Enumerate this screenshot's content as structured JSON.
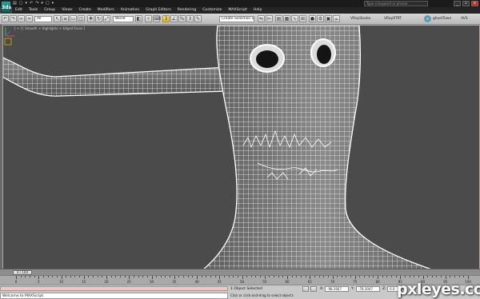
{
  "app": {
    "logo_text": "3ds",
    "title": "",
    "quick_access": [
      "▤",
      "▢",
      "▾",
      "↶",
      "↷",
      "▾",
      "▢",
      "▾"
    ],
    "help_search_placeholder": "Type a keyword or phrase",
    "window_controls": [
      "_",
      "▫",
      "x"
    ]
  },
  "menu": [
    "Edit",
    "Tools",
    "Group",
    "Views",
    "Create",
    "Modifiers",
    "Animation",
    "Graph Editors",
    "Rendering",
    "Customize",
    "MAXScript",
    "Help"
  ],
  "toolbar": {
    "filter_dropdown": "All",
    "refcoord_dropdown": "World",
    "selection_set_placeholder": "Create Selection Se",
    "vray_studio": "VRayStudio",
    "vray_rt": "VRayRTRT",
    "ghost_town": "ghostTown",
    "avs": "AVS"
  },
  "viewport": {
    "label": "[ + ] [ Smooth + Highlights + Edged Faces ]",
    "accent_color": "#e0b000",
    "mesh_color": "#ffffff",
    "background_color": "#4b4b4b"
  },
  "timeline": {
    "frame_readout": "0 / 100",
    "ticks": [
      "0",
      "5",
      "10",
      "15",
      "20",
      "25",
      "30",
      "35",
      "40",
      "45",
      "50",
      "55",
      "60",
      "65",
      "70",
      "75",
      "80",
      "85",
      "90",
      "95",
      "100"
    ]
  },
  "statusbar": {
    "maxscript_output": "Welcome to MAXScript.",
    "selection_status": "1 Object Selected",
    "prompt": "Click or click-and-drag to select objects",
    "x_label": "X:",
    "x_value": "-98.2667",
    "y_label": "Y:",
    "y_value": "-78.3047",
    "z_label": "Z:",
    "z_value": "0.0"
  },
  "watermark": "pxleyes.com"
}
